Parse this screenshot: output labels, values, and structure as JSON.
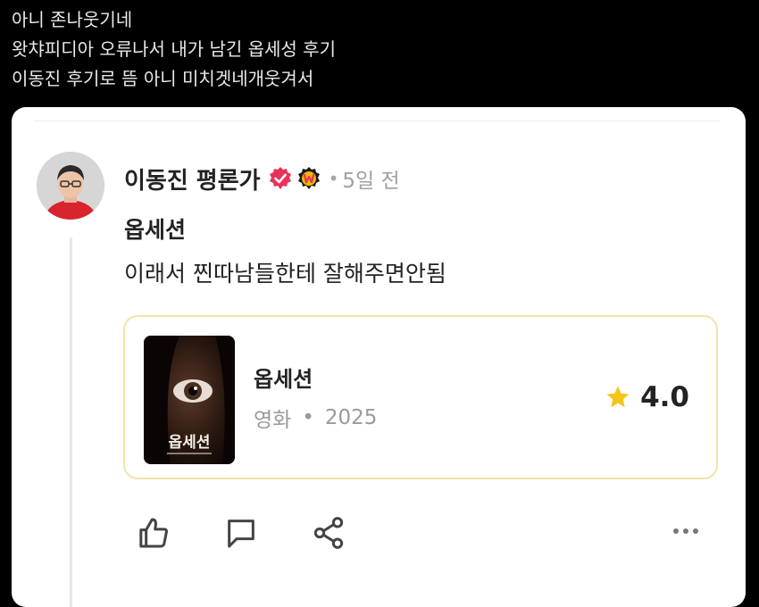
{
  "post": {
    "lines": [
      "아니 존나웃기네",
      "왓챠피디아 오류나서 내가 남긴 옵세성 후기",
      "이동진 후기로 뜸 아니 미치겟네개웃겨서"
    ]
  },
  "review": {
    "author": "이동진 평론가",
    "badges": [
      "verified-check-icon",
      "watcha-w-badge-icon"
    ],
    "dot": "•",
    "time": "5일 전",
    "title": "옵세션",
    "body": "이래서 찐따남들한테 잘해주면안됨"
  },
  "movie": {
    "title": "옵세션",
    "type": "영화",
    "separator": "•",
    "year": "2025",
    "rating": "4.0",
    "poster_title": "옵세션",
    "accent_color": "#f3e3a8",
    "star_color": "#f5c518"
  },
  "actions": {
    "icons": [
      "thumbs-up-icon",
      "comment-icon",
      "share-icon",
      "more-icon"
    ]
  },
  "colors": {
    "badge_red": "#e8325a",
    "page_bg": "#000000",
    "card_bg": "#ffffff"
  }
}
